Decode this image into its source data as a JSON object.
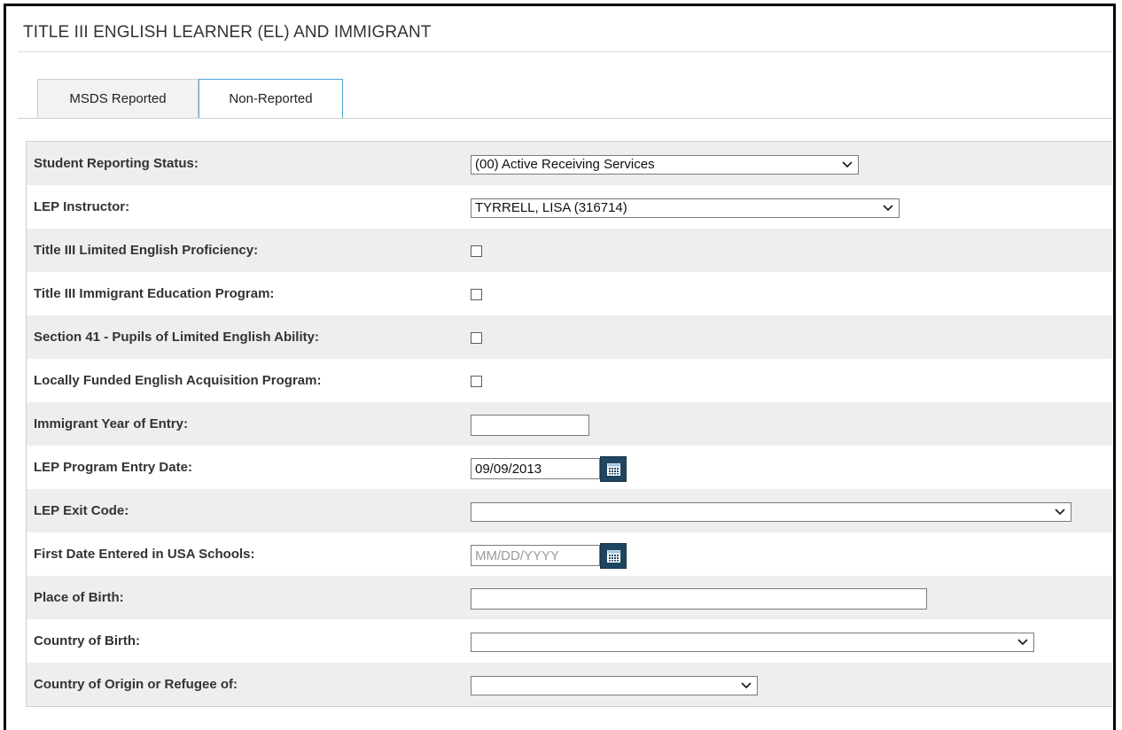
{
  "page": {
    "title": "TITLE III ENGLISH LEARNER (EL) AND IMMIGRANT"
  },
  "tabs": [
    {
      "label": "MSDS Reported",
      "active": false
    },
    {
      "label": "Non-Reported",
      "active": true
    }
  ],
  "form": {
    "student_reporting_status": {
      "label": "Student Reporting Status:",
      "value": "(00) Active Receiving Services"
    },
    "lep_instructor": {
      "label": "LEP Instructor:",
      "value": "TYRRELL, LISA (316714)"
    },
    "title3_lep": {
      "label": "Title III Limited English Proficiency:",
      "checked": false
    },
    "title3_immigrant": {
      "label": "Title III Immigrant Education Program:",
      "checked": false
    },
    "section41": {
      "label": "Section 41 - Pupils of Limited English Ability:",
      "checked": false
    },
    "locally_funded": {
      "label": "Locally Funded English Acquisition Program:",
      "checked": false
    },
    "immigrant_year": {
      "label": "Immigrant Year of Entry:",
      "value": ""
    },
    "lep_entry_date": {
      "label": "LEP Program Entry Date:",
      "value": "09/09/2013"
    },
    "lep_exit_code": {
      "label": "LEP Exit Code:",
      "value": ""
    },
    "first_date_usa": {
      "label": "First Date Entered in USA Schools:",
      "value": "",
      "placeholder": "MM/DD/YYYY"
    },
    "place_of_birth": {
      "label": "Place of Birth:",
      "value": ""
    },
    "country_of_birth": {
      "label": "Country of Birth:",
      "value": ""
    },
    "country_of_origin": {
      "label": "Country of Origin or Refugee of:",
      "value": ""
    }
  },
  "icons": {
    "dropdown": "chevron-down-icon",
    "calendar": "calendar-icon"
  },
  "colors": {
    "row_alt_bg": "#eeeeee",
    "active_tab_border": "#4aa8d8",
    "calendar_button_bg": "#1f4660"
  }
}
